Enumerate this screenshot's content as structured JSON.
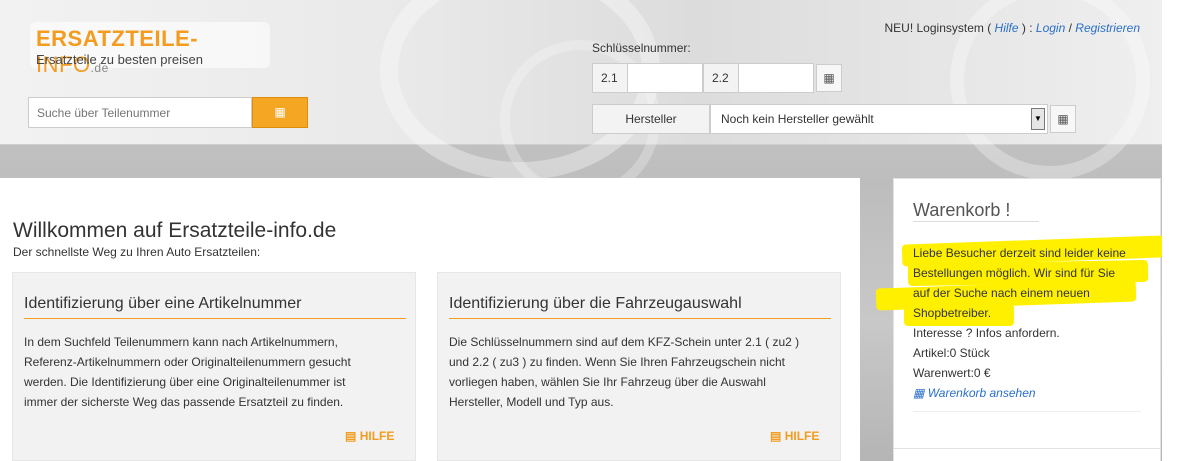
{
  "header": {
    "logo_a": "ERSATZTEILE-",
    "logo_b": "INFO",
    "logo_tld": ".de",
    "tagline": "Ersatzteile zu besten preisen",
    "search_placeholder": "Suche über Teilenummer",
    "login": {
      "prefix": "NEU! Loginsystem ( ",
      "help_link": "Hilfe",
      "mid": " ) : ",
      "login_link": "Login",
      "sep": " / ",
      "register_link": "Registrieren"
    },
    "key_label": "Schlüsselnummer:",
    "key_21": "2.1",
    "key_22": "2.2",
    "manufacturer_label": "Hersteller",
    "manufacturer_value": "Noch kein Hersteller gewählt"
  },
  "main": {
    "title": "Willkommen auf Ersatzteile-info.de",
    "subtitle": "Der schnellste Weg zu Ihren Auto Ersatzteilen:",
    "cards": [
      {
        "title": "Identifizierung über eine Artikelnummer",
        "lines": [
          "In dem Suchfeld Teilenummern kann nach Artikelnummern,",
          "Referenz-Artikelnummern oder Originalteilenummern gesucht",
          "werden. Die Identifizierung über eine Originalteilenummer ist",
          "immer der sicherste Weg das passende Ersatzteil zu finden."
        ],
        "help": "HILFE"
      },
      {
        "title": "Identifizierung über die Fahrzeugauswahl",
        "lines": [
          "Die Schlüsselnummern sind auf dem KFZ-Schein unter 2.1 ( zu2 )",
          "und 2.2 ( zu3 ) zu finden. Wenn Sie Ihren Fahrzeugschein nicht",
          "vorliegen haben, wählen Sie Ihr Fahrzeug über die Auswahl",
          "Hersteller, Modell und Typ aus."
        ],
        "help": "HILFE"
      }
    ]
  },
  "cart": {
    "title": "Warenkorb !",
    "notice_lines": [
      "Liebe Besucher derzeit sind leider keine",
      "Bestellungen möglich. Wir sind für Sie",
      "auf der Suche nach einem neuen",
      "Shopbetreiber."
    ],
    "interest": "Interesse ? Infos anfordern.",
    "articles": "Artikel:0 Stück",
    "value": "Warenwert:0 €",
    "view_link": "Warenkorb ansehen"
  },
  "colors": {
    "accent": "#f39c1f",
    "link": "#2a6fc9",
    "highlight": "#fff000"
  }
}
